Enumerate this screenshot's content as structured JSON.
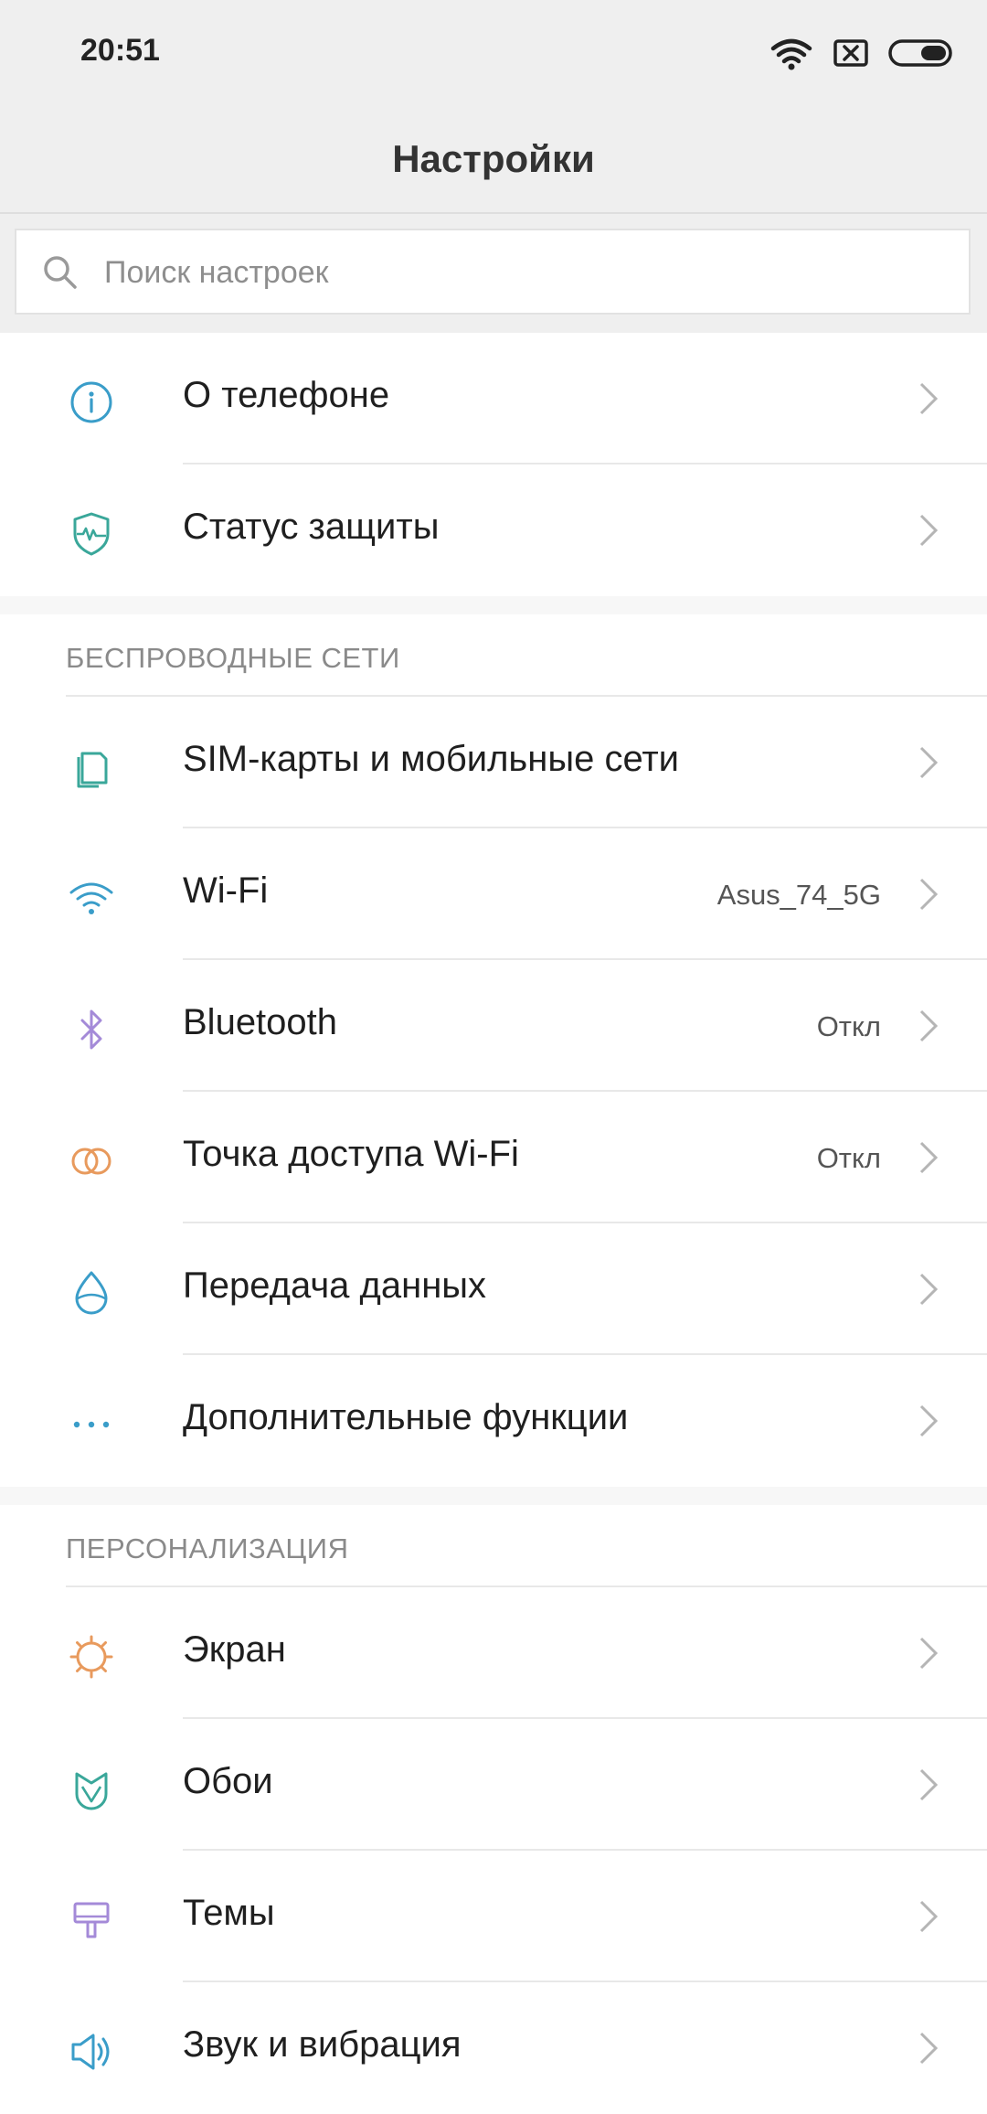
{
  "status_bar": {
    "time": "20:51"
  },
  "header": {
    "title": "Настройки"
  },
  "search": {
    "placeholder": "Поиск настроек"
  },
  "groups": [
    {
      "items": [
        {
          "label": "О телефоне",
          "value": "",
          "icon": "info-icon",
          "color": "#3a9dc9"
        },
        {
          "label": "Статус защиты",
          "value": "",
          "icon": "shield-icon",
          "color": "#3aa79a"
        }
      ]
    },
    {
      "title": "БЕСПРОВОДНЫЕ СЕТИ",
      "items": [
        {
          "label": "SIM-карты и мобильные сети",
          "value": "",
          "icon": "sim-card-icon",
          "color": "#3aa79a"
        },
        {
          "label": "Wi-Fi",
          "value": "Asus_74_5G",
          "icon": "wifi-icon",
          "color": "#3a9dc9"
        },
        {
          "label": "Bluetooth",
          "value": "Откл",
          "icon": "bluetooth-icon",
          "color": "#a48ad8"
        },
        {
          "label": "Точка доступа Wi-Fi",
          "value": "Откл",
          "icon": "hotspot-icon",
          "color": "#e89a5d"
        },
        {
          "label": "Передача данных",
          "value": "",
          "icon": "data-usage-icon",
          "color": "#3a9dc9"
        },
        {
          "label": "Дополнительные функции",
          "value": "",
          "icon": "more-dots-icon",
          "color": "#3a9dc9"
        }
      ]
    },
    {
      "title": "ПЕРСОНАЛИЗАЦИЯ",
      "items": [
        {
          "label": "Экран",
          "value": "",
          "icon": "sun-icon",
          "color": "#e89a5d"
        },
        {
          "label": "Обои",
          "value": "",
          "icon": "wallpaper-icon",
          "color": "#3aa79a"
        },
        {
          "label": "Темы",
          "value": "",
          "icon": "brush-icon",
          "color": "#a48ad8"
        },
        {
          "label": "Звук и вибрация",
          "value": "",
          "icon": "speaker-icon",
          "color": "#3a9dc9"
        }
      ]
    }
  ]
}
